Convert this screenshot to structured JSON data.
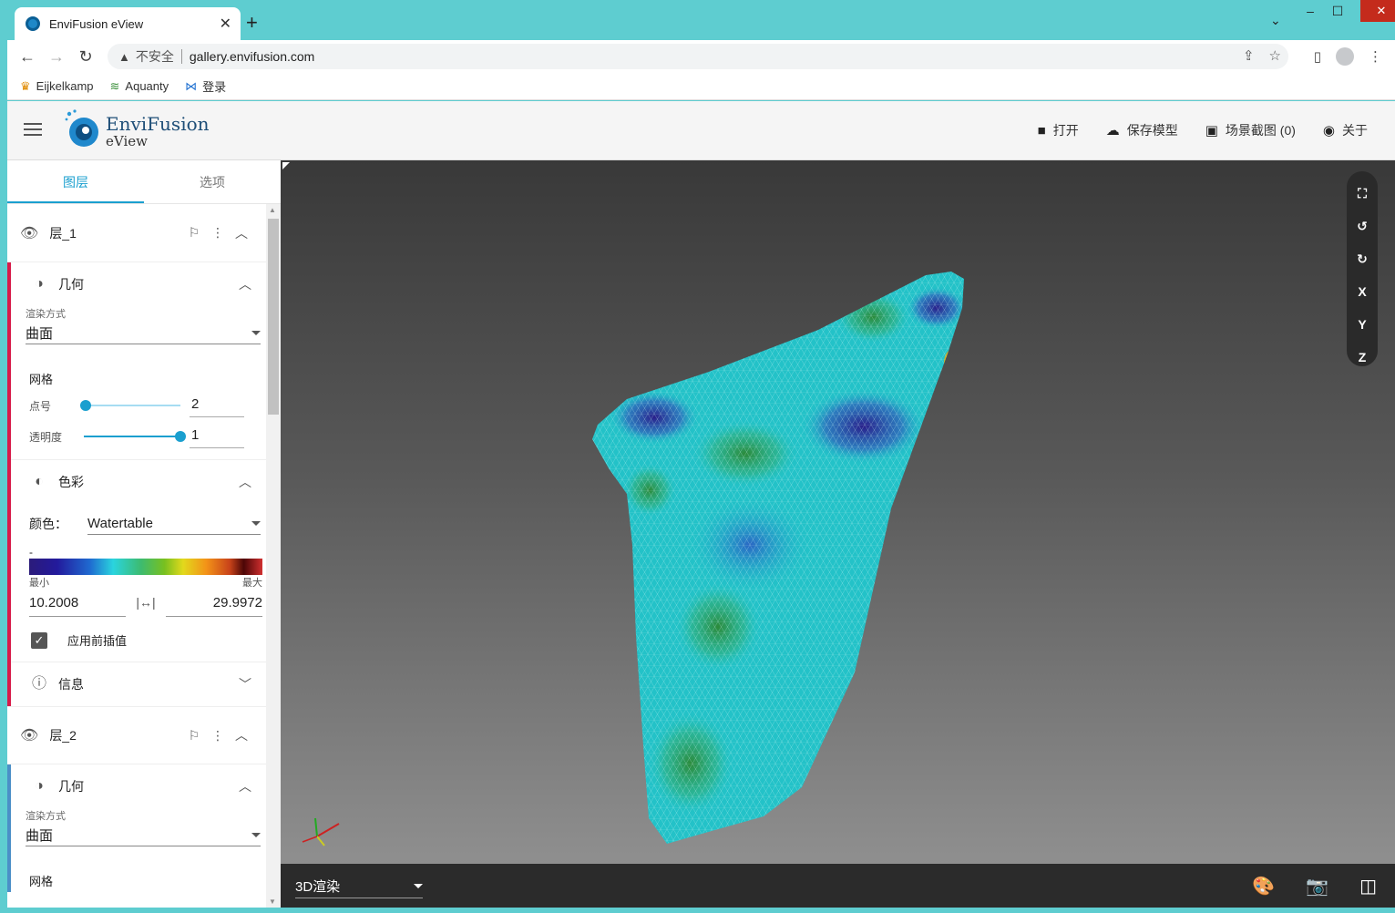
{
  "browser": {
    "tab_title": "EnviFusion eView",
    "new_tab": "+",
    "security_label": "不安全",
    "url": "gallery.envifusion.com",
    "bookmarks": [
      {
        "label": "Eijkelkamp",
        "icon": "eijkelkamp-icon"
      },
      {
        "label": "Aquanty",
        "icon": "aquanty-icon"
      },
      {
        "label": "登录",
        "icon": "login-icon"
      }
    ]
  },
  "app": {
    "brand_line1": "EnviFusion",
    "brand_line2": "eView",
    "actions": [
      {
        "label": "打开",
        "icon": "folder-icon"
      },
      {
        "label": "保存模型",
        "icon": "cloud-upload-icon"
      },
      {
        "label": "场景截图 (0)",
        "icon": "image-icon"
      },
      {
        "label": "关于",
        "icon": "info-logo-icon"
      }
    ]
  },
  "panel": {
    "tabs": [
      "图层",
      "选项"
    ],
    "layer1": {
      "name": "层_1",
      "geometry": {
        "title": "几何",
        "render_label": "渲染方式",
        "render_value": "曲面",
        "mesh_label": "网格",
        "point_label": "点号",
        "point_value": "2",
        "opacity_label": "透明度",
        "opacity_value": "1"
      },
      "color": {
        "title": "色彩",
        "color_label": "颜色：",
        "color_value": "Watertable",
        "dash": "-",
        "min_label": "最小",
        "max_label": "最大",
        "min_value": "10.2008",
        "max_value": "29.9972",
        "interp_label": "应用前插值"
      },
      "info": {
        "title": "信息"
      }
    },
    "layer2": {
      "name": "层_2",
      "geometry": {
        "title": "几何",
        "render_label": "渲染方式",
        "render_value": "曲面",
        "mesh_label": "网格"
      }
    }
  },
  "viewport": {
    "tools": [
      "⛶",
      "↺",
      "↻",
      "X",
      "Y",
      "Z"
    ],
    "render_mode": "3D渲染"
  },
  "colors": {
    "accent": "#1a9fcf",
    "layer1_bar": "#d81b4a",
    "layer2_bar": "#4b8fc7",
    "tabstrip": "#5ecdd0"
  }
}
